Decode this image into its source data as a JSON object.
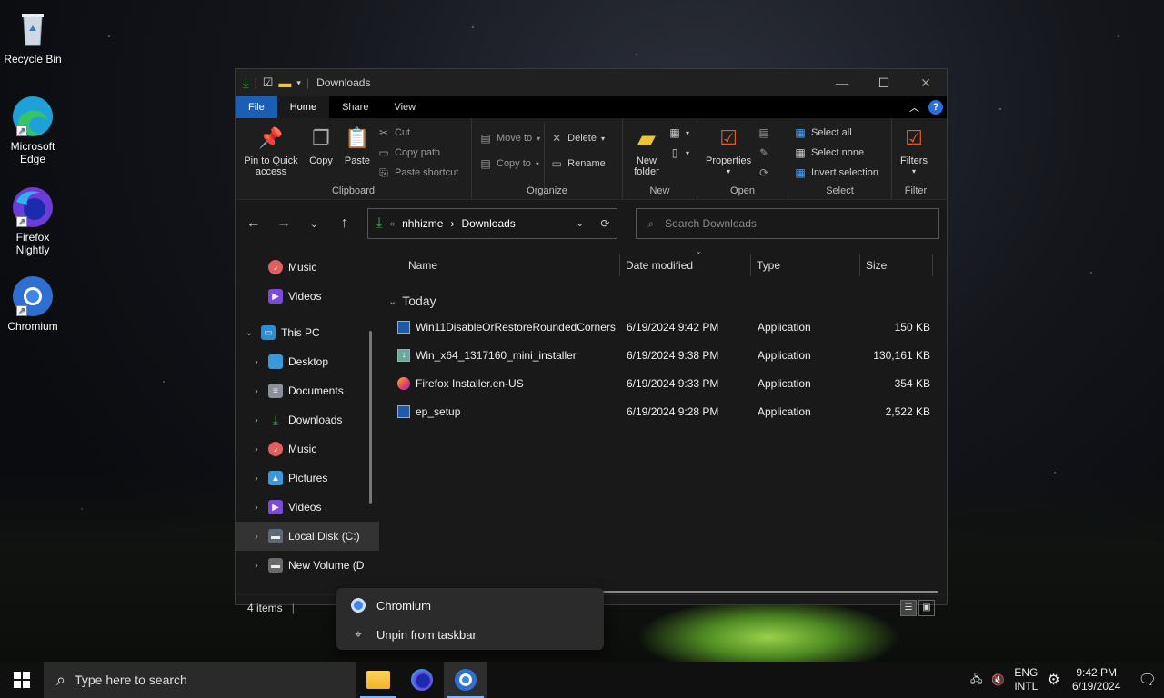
{
  "desktop": {
    "icons": [
      {
        "label": "Recycle Bin"
      },
      {
        "label": "Microsoft Edge"
      },
      {
        "label": "Firefox Nightly"
      },
      {
        "label": "Chromium"
      }
    ]
  },
  "window": {
    "title": "Downloads",
    "tabs": {
      "file": "File",
      "home": "Home",
      "share": "Share",
      "view": "View"
    },
    "ribbon": {
      "clipboard": {
        "label": "Clipboard",
        "pin": "Pin to Quick access",
        "copy": "Copy",
        "paste": "Paste",
        "cut": "Cut",
        "copy_path": "Copy path",
        "paste_shortcut": "Paste shortcut"
      },
      "organize": {
        "label": "Organize",
        "move_to": "Move to",
        "copy_to": "Copy to",
        "delete": "Delete",
        "rename": "Rename"
      },
      "new": {
        "label": "New",
        "new_folder": "New folder"
      },
      "open": {
        "label": "Open",
        "properties": "Properties"
      },
      "select": {
        "label": "Select",
        "select_all": "Select all",
        "select_none": "Select none",
        "invert": "Invert selection"
      },
      "filter": {
        "label": "Filter",
        "filters": "Filters"
      }
    },
    "address": {
      "crumbs": [
        "nhhizme",
        "Downloads"
      ],
      "separator": "›"
    },
    "search": {
      "placeholder": "Search Downloads"
    },
    "nav": {
      "items": [
        {
          "label": "Music",
          "type": "quick"
        },
        {
          "label": "Videos",
          "type": "quick"
        },
        {
          "label": "This PC",
          "type": "root"
        },
        {
          "label": "Desktop",
          "type": "child"
        },
        {
          "label": "Documents",
          "type": "child"
        },
        {
          "label": "Downloads",
          "type": "child"
        },
        {
          "label": "Music",
          "type": "child"
        },
        {
          "label": "Pictures",
          "type": "child"
        },
        {
          "label": "Videos",
          "type": "child"
        },
        {
          "label": "Local Disk (C:)",
          "type": "child"
        },
        {
          "label": "New Volume (D",
          "type": "child"
        }
      ]
    },
    "columns": {
      "name": "Name",
      "date": "Date modified",
      "type": "Type",
      "size": "Size"
    },
    "group": "Today",
    "files": [
      {
        "name": "Win11DisableOrRestoreRoundedCorners",
        "date": "6/19/2024 9:42 PM",
        "type": "Application",
        "size": "150 KB"
      },
      {
        "name": "Win_x64_1317160_mini_installer",
        "date": "6/19/2024 9:38 PM",
        "type": "Application",
        "size": "130,161 KB"
      },
      {
        "name": "Firefox Installer.en-US",
        "date": "6/19/2024 9:33 PM",
        "type": "Application",
        "size": "354 KB"
      },
      {
        "name": "ep_setup",
        "date": "6/19/2024 9:28 PM",
        "type": "Application",
        "size": "2,522 KB"
      }
    ],
    "status": {
      "count": "4 items"
    }
  },
  "context_menu": {
    "items": [
      {
        "label": "Chromium"
      },
      {
        "label": "Unpin from taskbar"
      }
    ]
  },
  "taskbar": {
    "search_placeholder": "Type here to search",
    "lang": {
      "line1": "ENG",
      "line2": "INTL"
    },
    "clock": {
      "time": "9:42 PM",
      "date": "6/19/2024"
    }
  },
  "colors": {
    "file_tab": "#1a5fb4",
    "accent_green": "#3bb34a",
    "help": "#2a6fdb"
  }
}
